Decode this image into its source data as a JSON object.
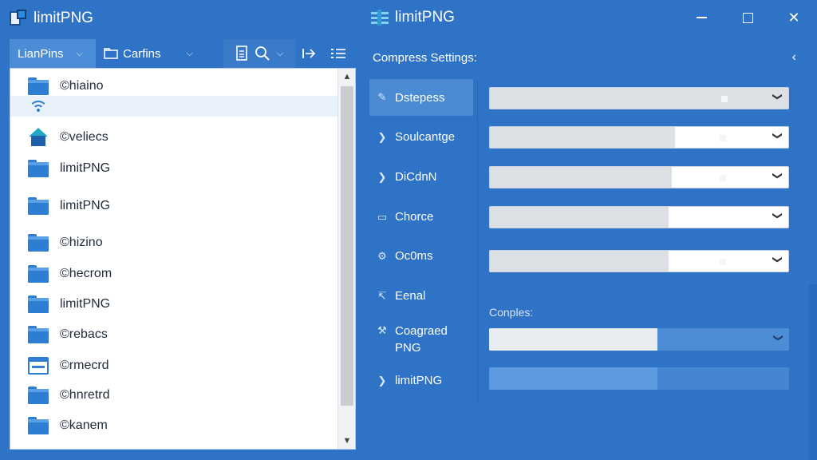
{
  "left_window": {
    "title": "limitPNG",
    "toolbar": {
      "tab_active_label": "LianPins",
      "tab_second_label": "Carfins"
    },
    "files": [
      {
        "name": "hiaino",
        "icon": "folder",
        "marker": "©"
      },
      {
        "name": "",
        "icon": "wifi",
        "marker": ""
      },
      {
        "name": "veliecs",
        "icon": "home",
        "marker": "©"
      },
      {
        "name": "limitPNG",
        "icon": "folder",
        "marker": ""
      },
      {
        "name": "limitPNG",
        "icon": "folder",
        "marker": ""
      },
      {
        "name": "hizino",
        "icon": "folder",
        "marker": "©"
      },
      {
        "name": "hecrom",
        "icon": "folder",
        "marker": "©"
      },
      {
        "name": "limitPNG",
        "icon": "folder",
        "marker": ""
      },
      {
        "name": "rebacs",
        "icon": "folder",
        "marker": "©"
      },
      {
        "name": "rmecrd",
        "icon": "window",
        "marker": "©"
      },
      {
        "name": "hnretrd",
        "icon": "folder",
        "marker": "©"
      },
      {
        "name": "kanem",
        "icon": "folder",
        "marker": "©"
      }
    ]
  },
  "right_window": {
    "title": "limitPNG",
    "settings_heading": "Compress Settings:",
    "nav": [
      {
        "label": "Dstepess",
        "icon": "pencil-icon",
        "active": true
      },
      {
        "label": "Soulcantge",
        "icon": "chevron-right-icon",
        "active": false
      },
      {
        "label": "DiCdnN",
        "icon": "chevron-right-icon",
        "active": false
      },
      {
        "label": "Chorce",
        "icon": "monitor-icon",
        "active": false
      },
      {
        "label": "Oc0ms",
        "icon": "gear-icon",
        "active": false
      },
      {
        "label": "Eenal",
        "icon": "arrows-icon",
        "active": false
      },
      {
        "label": "Coagraed PNG",
        "icon": "tools-icon",
        "active": false
      },
      {
        "label": "limitPNG",
        "icon": "chevron-right-icon",
        "active": false
      }
    ],
    "fields": [
      {
        "level": 1.0
      },
      {
        "level": 0.62
      },
      {
        "level": 0.61
      },
      {
        "level": 0.6
      },
      {
        "level": 0.6
      }
    ],
    "compress_label": "Conples:",
    "compress_progress": 0.56,
    "secondary_progress": 0.56
  },
  "colors": {
    "background": "#2f73c6",
    "accent": "#4a8bd4",
    "folder": "#2d7dd2"
  }
}
